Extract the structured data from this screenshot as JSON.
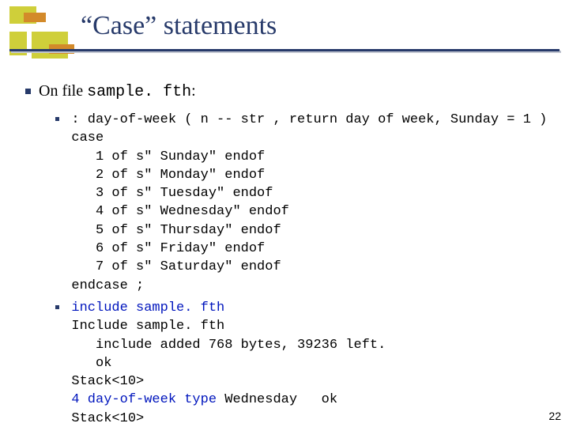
{
  "title": "“Case” statements",
  "intro_prefix": "On file ",
  "intro_filename": "sample. fth",
  "intro_suffix": ":",
  "code1_lines": [
    ": day-of-week ( n -- str , return day of week, Sunday = 1 )",
    "case",
    "   1 of s\" Sunday\" endof",
    "   2 of s\" Monday\" endof",
    "   3 of s\" Tuesday\" endof",
    "   4 of s\" Wednesday\" endof",
    "   5 of s\" Thursday\" endof",
    "   6 of s\" Friday\" endof",
    "   7 of s\" Saturday\" endof",
    "endcase ;"
  ],
  "code2_line1_blue": "include sample. fth",
  "code2_line2": "Include sample. fth",
  "code2_line3": "   include added 768 bytes, 39236 left.",
  "code2_line4": "   ok",
  "code2_line5": "Stack<10>",
  "code2_line6_blue": "4 day-of-week type ",
  "code2_line6_rest": "Wednesday   ok",
  "code2_line7": "Stack<10>",
  "page_number": "22"
}
